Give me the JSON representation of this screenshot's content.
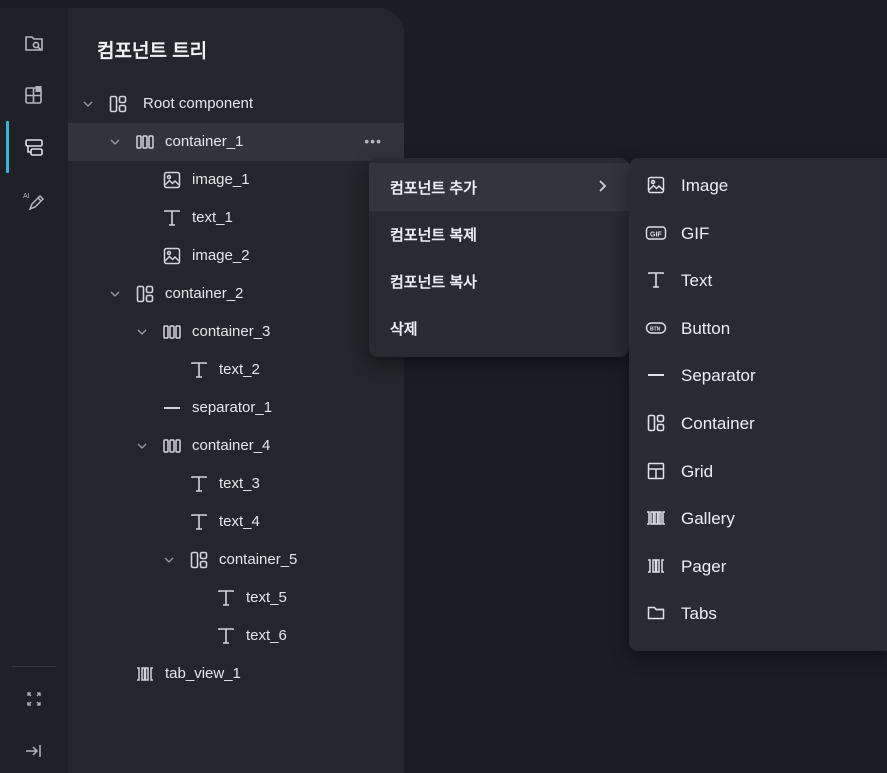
{
  "panel": {
    "title": "컴포넌트 트리",
    "rail_icons": [
      "browse-icon",
      "add-widget-icon",
      "component-tree-icon",
      "ai-edit-icon",
      "collapse-icon",
      "dock-right-icon"
    ],
    "tree": [
      {
        "label": "Root component",
        "icon": "container-icon",
        "depth": 0,
        "expanded": true,
        "selected": false
      },
      {
        "label": "container_1",
        "icon": "row-container-icon",
        "depth": 1,
        "expanded": true,
        "selected": true
      },
      {
        "label": "image_1",
        "icon": "image-icon",
        "depth": 2,
        "expanded": null,
        "selected": false
      },
      {
        "label": "text_1",
        "icon": "text-icon",
        "depth": 2,
        "expanded": null,
        "selected": false
      },
      {
        "label": "image_2",
        "icon": "image-icon",
        "depth": 2,
        "expanded": null,
        "selected": false
      },
      {
        "label": "container_2",
        "icon": "container-icon",
        "depth": 1,
        "expanded": true,
        "selected": false
      },
      {
        "label": "container_3",
        "icon": "row-container-icon",
        "depth": 2,
        "expanded": true,
        "selected": false
      },
      {
        "label": "text_2",
        "icon": "text-icon",
        "depth": 3,
        "expanded": null,
        "selected": false
      },
      {
        "label": "separator_1",
        "icon": "separator-icon",
        "depth": 2,
        "expanded": null,
        "selected": false
      },
      {
        "label": "container_4",
        "icon": "row-container-icon",
        "depth": 2,
        "expanded": true,
        "selected": false
      },
      {
        "label": "text_3",
        "icon": "text-icon",
        "depth": 3,
        "expanded": null,
        "selected": false
      },
      {
        "label": "text_4",
        "icon": "text-icon",
        "depth": 3,
        "expanded": null,
        "selected": false
      },
      {
        "label": "container_5",
        "icon": "container-icon",
        "depth": 3,
        "expanded": true,
        "selected": false
      },
      {
        "label": "text_5",
        "icon": "text-icon",
        "depth": 4,
        "expanded": null,
        "selected": false
      },
      {
        "label": "text_6",
        "icon": "text-icon",
        "depth": 4,
        "expanded": null,
        "selected": false
      },
      {
        "label": "tab_view_1",
        "icon": "pager-icon",
        "depth": 1,
        "expanded": null,
        "selected": false
      }
    ],
    "more_label": "•••"
  },
  "context_menu": {
    "items": [
      {
        "label": "컴포넌트 추가",
        "has_submenu": true,
        "active": true
      },
      {
        "label": "컴포넌트 복제",
        "has_submenu": false,
        "active": false
      },
      {
        "label": "컴포넌트 복사",
        "has_submenu": false,
        "active": false
      },
      {
        "label": "삭제",
        "has_submenu": false,
        "active": false
      }
    ]
  },
  "submenu": {
    "items": [
      {
        "label": "Image",
        "icon": "image-icon"
      },
      {
        "label": "GIF",
        "icon": "gif-icon"
      },
      {
        "label": "Text",
        "icon": "text-icon"
      },
      {
        "label": "Button",
        "icon": "button-icon"
      },
      {
        "label": "Separator",
        "icon": "separator-icon"
      },
      {
        "label": "Container",
        "icon": "container-icon"
      },
      {
        "label": "Grid",
        "icon": "grid-icon"
      },
      {
        "label": "Gallery",
        "icon": "gallery-icon"
      },
      {
        "label": "Pager",
        "icon": "pager-icon"
      },
      {
        "label": "Tabs",
        "icon": "tabs-icon"
      }
    ]
  },
  "colors": {
    "background": "#1c1d24",
    "panel": "#25262b",
    "rail": "#202126",
    "selected_row": "#33343a",
    "accent": "#3ab3d9",
    "menu": "#2a2b31"
  }
}
